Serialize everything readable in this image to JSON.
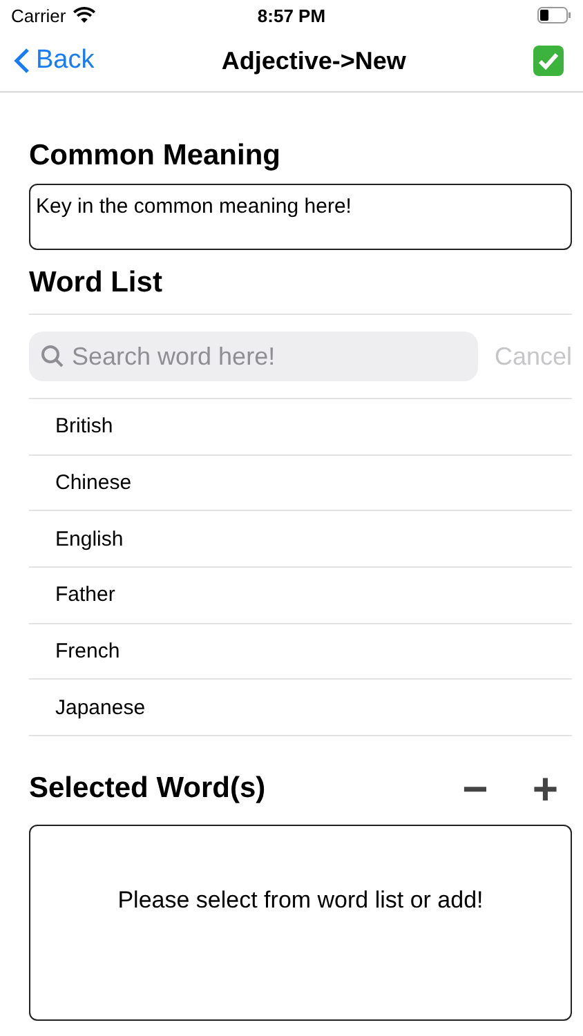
{
  "status_bar": {
    "carrier": "Carrier",
    "time": "8:57 PM"
  },
  "nav": {
    "back": "Back",
    "title": "Adjective->New"
  },
  "common_meaning": {
    "heading": "Common Meaning",
    "value": "Key in the common meaning here!"
  },
  "word_list": {
    "heading": "Word List",
    "search": {
      "placeholder": "Search word here!",
      "cancel": "Cancel"
    },
    "rows": [
      {
        "label": "British"
      },
      {
        "label": "Chinese"
      },
      {
        "label": "English"
      },
      {
        "label": "Father"
      },
      {
        "label": "French"
      },
      {
        "label": "Japanese"
      }
    ]
  },
  "selected_words": {
    "heading": "Selected Word(s)",
    "remove": "−",
    "add": "+",
    "empty_message": "Please select from word list or add!"
  }
}
